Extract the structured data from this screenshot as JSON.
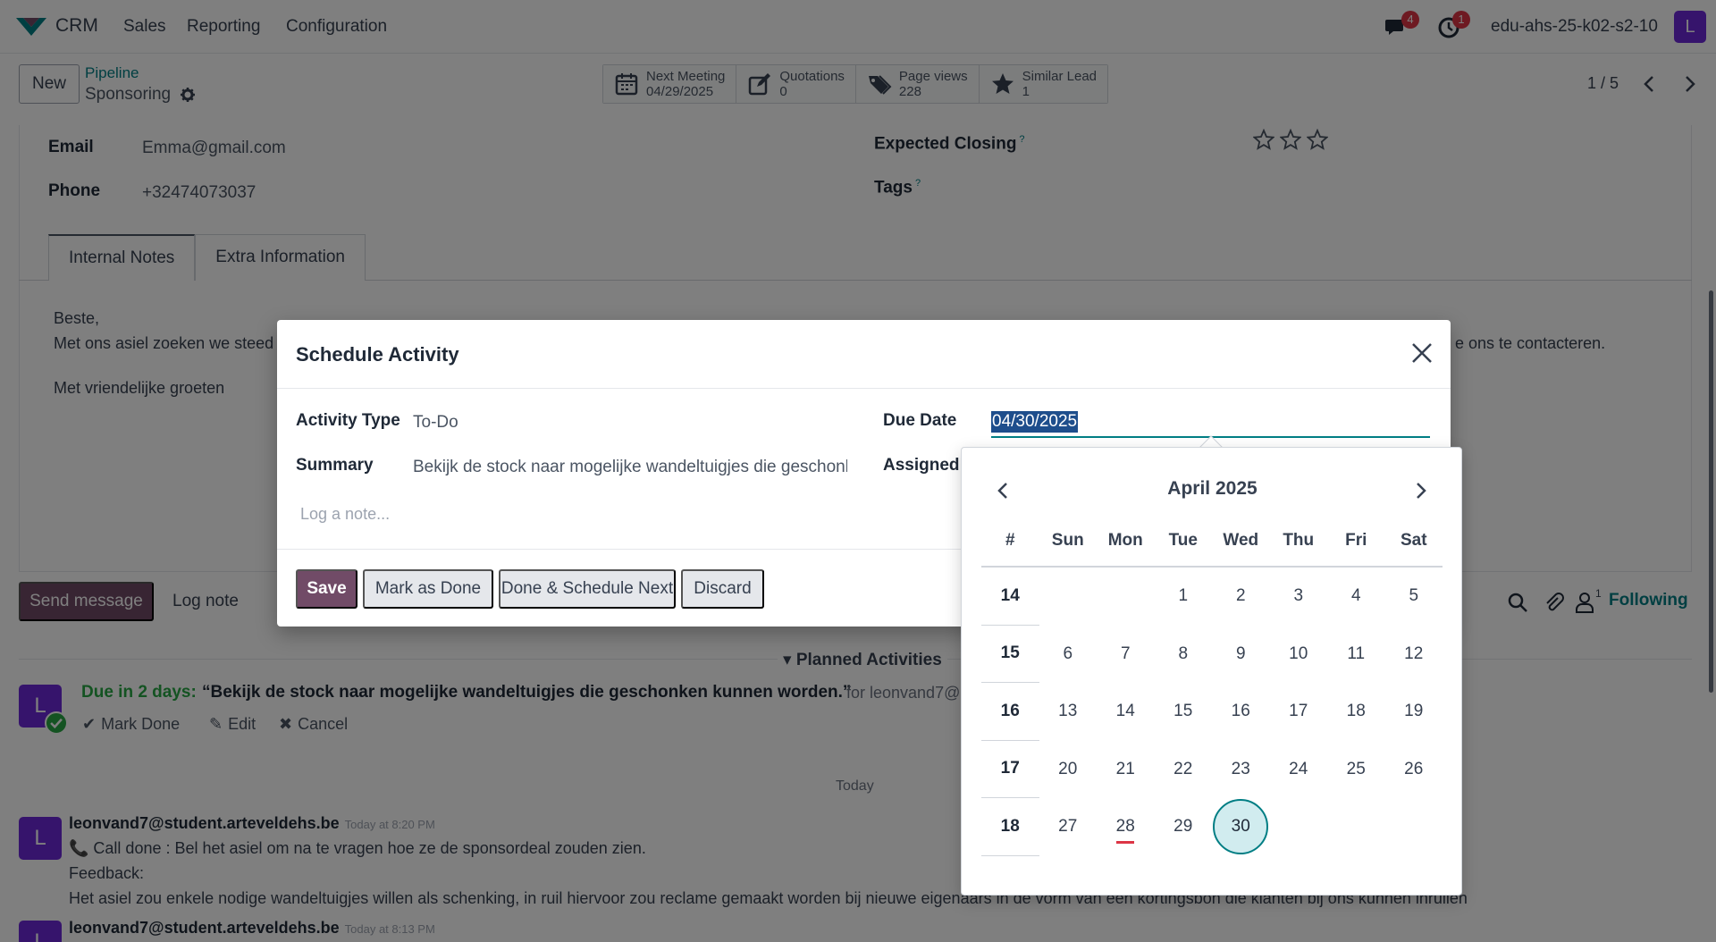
{
  "navbar": {
    "app_name": "CRM",
    "menus": [
      "Sales",
      "Reporting",
      "Configuration"
    ],
    "messages_badge": "4",
    "activities_badge": "1",
    "database": "edu-ahs-25-k02-s2-10",
    "avatar_letter": "L",
    "avatar_color": "#6d28d9"
  },
  "control_panel": {
    "new_label": "New",
    "breadcrumb_parent": "Pipeline",
    "breadcrumb_current": "Sponsoring",
    "stats": [
      {
        "icon": "calendar-icon",
        "label": "Next Meeting",
        "value": "04/29/2025"
      },
      {
        "icon": "pencil-square-icon",
        "label": "Quotations",
        "value": "0"
      },
      {
        "icon": "tags-icon",
        "label": "Page views",
        "value": "228"
      },
      {
        "icon": "star-icon",
        "label": "Similar Lead",
        "value": "1"
      }
    ],
    "pager": "1 / 5"
  },
  "form": {
    "email_label": "Email",
    "email_value": "Emma@gmail.com",
    "phone_label": "Phone",
    "phone_value": "+32474073037",
    "expected_closing_label": "Expected Closing",
    "tags_label": "Tags",
    "help_mark": "?",
    "priority_stars": 0,
    "tabs": [
      "Internal Notes",
      "Extra Information"
    ],
    "note_lines": [
      "Beste,",
      "Met ons asiel zoeken we steed",
      "e ons te contacteren.",
      "Met vriendelijke groeten"
    ]
  },
  "chatter": {
    "send_message": "Send message",
    "log_note": "Log note",
    "followers_count": "1",
    "following": "Following",
    "planned_activities": "Planned Activities",
    "activity": {
      "due": "Due in 2 days:",
      "title": "“Bekijk de stock naar mogelijke wandeltuigjes die geschonken kunnen worden.”",
      "for": "for leonvand7@",
      "mark_done": "Mark Done",
      "edit": "Edit",
      "cancel": "Cancel"
    },
    "today_label": "Today",
    "messages": [
      {
        "author": "leonvand7@student.arteveldehs.be",
        "time": "Today at 8:20 PM",
        "line1": "Call done : Bel het asiel om na te vragen hoe ze de sponsordeal zouden zien.",
        "line2": "Feedback:",
        "line3": "Het asiel zou enkele nodige wandeltuigjes willen als schenking, in ruil hiervoor zou reclame gemaakt worden bij nieuwe eigenaars in de vorm van een kortingsbon die klanten bij ons kunnen inruilen"
      },
      {
        "author": "leonvand7@student.arteveldehs.be",
        "time": "Today at 8:13 PM"
      }
    ]
  },
  "dialog": {
    "title": "Schedule Activity",
    "activity_type_label": "Activity Type",
    "activity_type_value": "To-Do",
    "summary_label": "Summary",
    "summary_value": "Bekijk de stock naar mogelijke wandeltuigjes die geschonk",
    "due_date_label": "Due Date",
    "due_date_value": "04/30/2025",
    "assigned_label": "Assigned t",
    "note_placeholder": "Log a note...",
    "buttons": {
      "save": "Save",
      "mark_done": "Mark as Done",
      "done_next": "Done & Schedule Next",
      "discard": "Discard"
    }
  },
  "datepicker": {
    "month": "April 2025",
    "week_header": "#",
    "weekdays": [
      "Sun",
      "Mon",
      "Tue",
      "Wed",
      "Thu",
      "Fri",
      "Sat"
    ],
    "weeks": [
      {
        "week": "14",
        "days": [
          "",
          "",
          "1",
          "2",
          "3",
          "4",
          "5"
        ]
      },
      {
        "week": "15",
        "days": [
          "6",
          "7",
          "8",
          "9",
          "10",
          "11",
          "12"
        ]
      },
      {
        "week": "16",
        "days": [
          "13",
          "14",
          "15",
          "16",
          "17",
          "18",
          "19"
        ]
      },
      {
        "week": "17",
        "days": [
          "20",
          "21",
          "22",
          "23",
          "24",
          "25",
          "26"
        ]
      },
      {
        "week": "18",
        "days": [
          "27",
          "28",
          "29",
          "30",
          "",
          "",
          ""
        ]
      }
    ],
    "today": "28",
    "selected": "30"
  }
}
